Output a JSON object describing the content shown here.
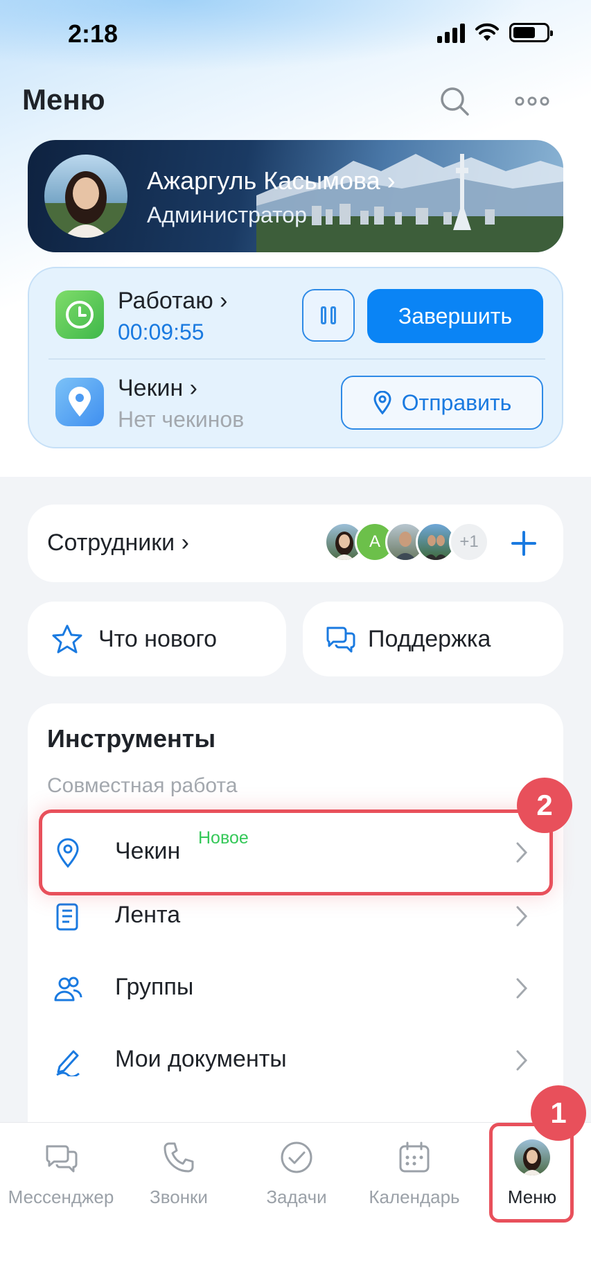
{
  "status_bar": {
    "time": "2:18"
  },
  "header": {
    "title": "Меню"
  },
  "profile": {
    "name": "Ажаргуль Касымова",
    "role": "Администратор"
  },
  "work": {
    "status_label": "Работаю",
    "timer": "00:09:55",
    "finish_label": "Завершить",
    "checkin_label": "Чекин",
    "checkin_sub": "Нет чекинов",
    "send_label": "Отправить"
  },
  "staff": {
    "label": "Сотрудники",
    "avatar_letter": "А",
    "more_count": "+1"
  },
  "quick": {
    "whats_new": "Что нового",
    "support": "Поддержка"
  },
  "tools": {
    "title": "Инструменты",
    "subtitle": "Совместная работа",
    "items": [
      {
        "label": "Чекин",
        "badge": "Новое",
        "icon": "pin-icon"
      },
      {
        "label": "Лента",
        "icon": "feed-icon"
      },
      {
        "label": "Группы",
        "icon": "groups-icon"
      },
      {
        "label": "Мои документы",
        "icon": "pen-icon"
      }
    ]
  },
  "annotations": {
    "step1": "1",
    "step2": "2"
  },
  "tab_bar": {
    "tabs": [
      {
        "label": "Мессенджер",
        "icon": "chat-icon"
      },
      {
        "label": "Звонки",
        "icon": "phone-icon"
      },
      {
        "label": "Задачи",
        "icon": "check-circle-icon"
      },
      {
        "label": "Календарь",
        "icon": "calendar-icon"
      },
      {
        "label": "Меню",
        "icon": "avatar-icon",
        "active": true
      }
    ]
  },
  "colors": {
    "accent": "#0a84f5",
    "highlight": "#e8505b",
    "new_badge": "#35c859"
  }
}
